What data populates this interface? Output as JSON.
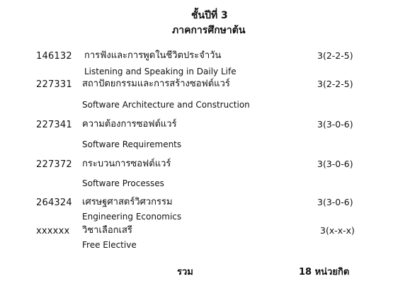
{
  "header": {
    "year": "ชั้นปีที่ 3",
    "semester": "ภาคการศึกษาต้น"
  },
  "courses": [
    {
      "code": "146132",
      "thai_name": "การฟังและการพูดในชีวิตประจำวัน",
      "english_name": "Listening and Speaking in Daily Life",
      "credits": "3(2-2-5)"
    },
    {
      "code": "227331",
      "thai_name": "สถาปัตยกรรมและการสร้างซอฟต์แวร์",
      "english_name": "Software Architecture and Construction",
      "credits": "3(2-2-5)"
    },
    {
      "code": "227341",
      "thai_name": "ความต้องการซอฟต์แวร์",
      "english_name": "Software Requirements",
      "credits": "3(3-0-6)"
    },
    {
      "code": "227372",
      "thai_name": "กระบวนการซอฟต์แวร์",
      "english_name": "Software Processes",
      "credits": "3(3-0-6)"
    },
    {
      "code": "264324",
      "thai_name": "เศรษฐศาสตร์วิศวกรรม",
      "english_name": "Engineering Economics",
      "credits": "3(3-0-6)"
    },
    {
      "code": "xxxxxx",
      "thai_name": "วิชาเลือกเสรี",
      "english_name": "Free Elective",
      "credits": "3(x-x-x)"
    }
  ],
  "total": {
    "label": "รวม",
    "value": "18 หน่วยกิต"
  }
}
